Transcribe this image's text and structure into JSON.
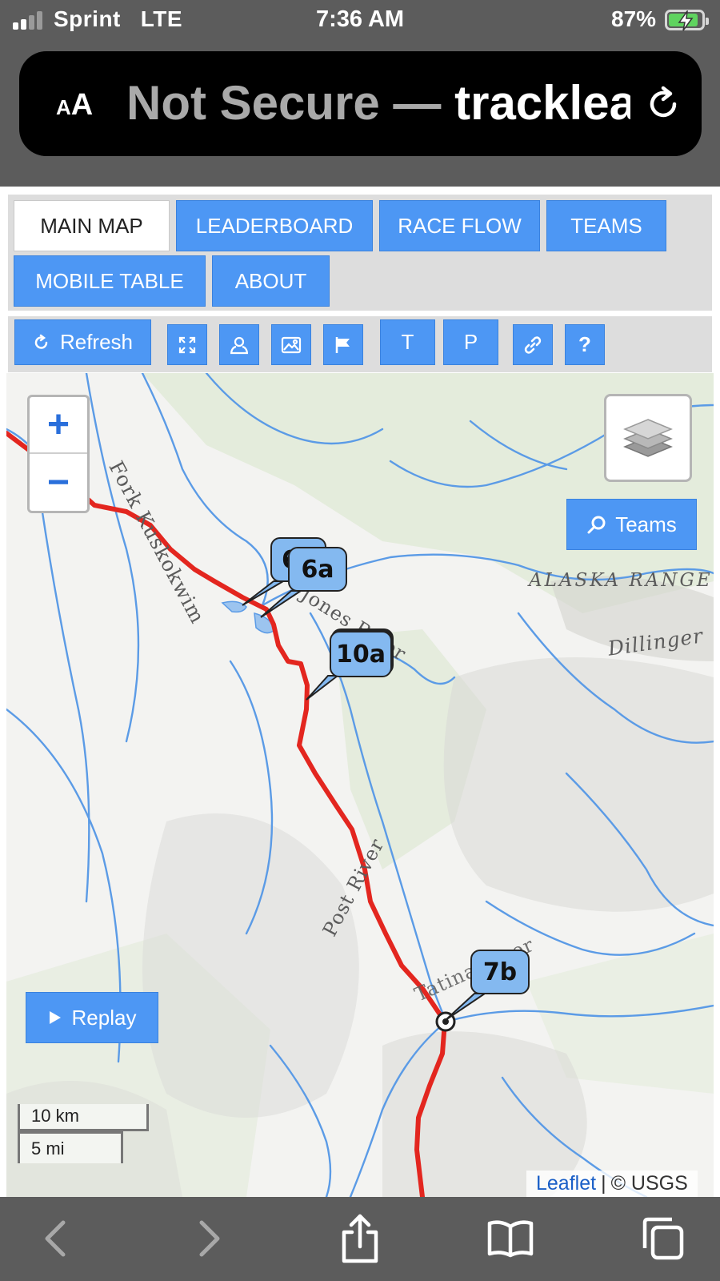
{
  "status_bar": {
    "carrier": "Sprint",
    "network": "LTE",
    "time": "7:36 AM",
    "battery_percent": "87%",
    "signal_bars": 2,
    "battery_level": 0.87,
    "battery_charging": true
  },
  "browser": {
    "text_size_button": {
      "small": "A",
      "large": "A"
    },
    "security_label": "Not Secure —",
    "url_host": "tracklea",
    "reload_icon": "reload-icon"
  },
  "nav_tabs": [
    {
      "label": "MAIN MAP",
      "active": true
    },
    {
      "label": "LEADERBOARD",
      "active": false
    },
    {
      "label": "RACE FLOW",
      "active": false
    },
    {
      "label": "TEAMS",
      "active": false
    },
    {
      "label": "MOBILE TABLE",
      "active": false
    },
    {
      "label": "ABOUT",
      "active": false
    }
  ],
  "toolbar": {
    "refresh_label": "Refresh",
    "t_label": "T",
    "p_label": "P",
    "help_label": "?",
    "icons": [
      "fullscreen-icon",
      "person-icon",
      "image-icon",
      "flag-icon",
      "link-icon",
      "help-icon"
    ]
  },
  "map": {
    "zoom_in": "+",
    "zoom_out": "−",
    "teams_button": "Teams",
    "replay_button": "Replay",
    "labels": {
      "kuskokwim": "Fork Kuskokwim",
      "alaska_range": "ALASKA RANGE",
      "jones_river": "Jones River",
      "dillinger": "Dillinger",
      "post_river": "Post River",
      "tatina_river": "Tatina River"
    },
    "markers": [
      {
        "label": "6",
        "hidden_behind": true
      },
      {
        "label": "6a"
      },
      {
        "label": "10a"
      },
      {
        "label": "7b"
      }
    ],
    "scale": {
      "km": "10 km",
      "mi": "5 mi"
    },
    "attribution": {
      "leaflet": "Leaflet",
      "separator": "|",
      "source": "© USGS"
    },
    "colors": {
      "route": "#e3261f",
      "rivers": "#5b9be6",
      "buttons": "#4d97f4"
    }
  },
  "bottom_bar": {
    "icons": [
      "back-icon",
      "forward-icon",
      "share-icon",
      "bookmarks-icon",
      "tabs-icon"
    ]
  }
}
